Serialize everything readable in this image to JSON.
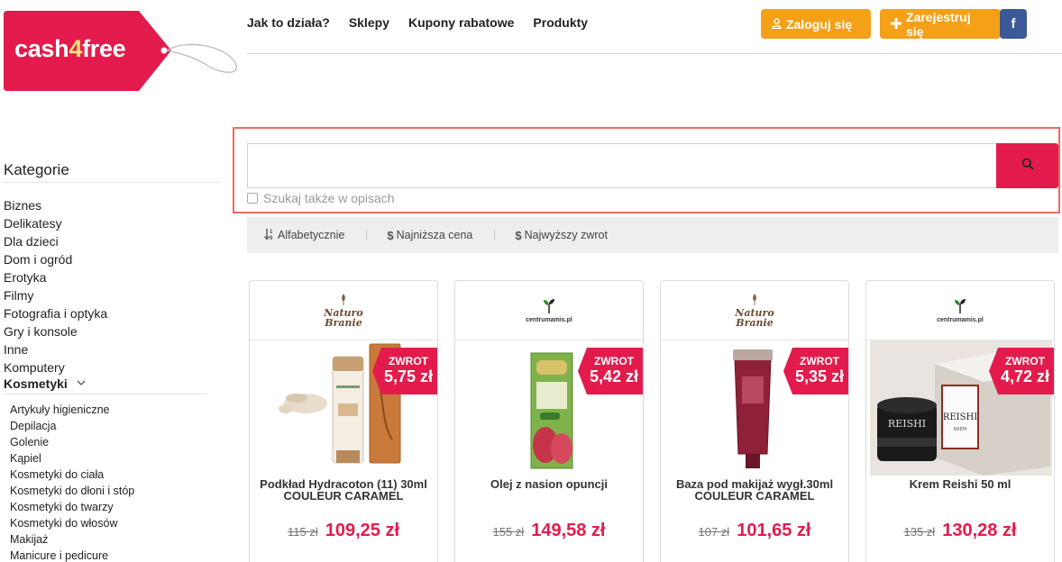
{
  "brand": {
    "logo_main": "cash",
    "logo_four": "4",
    "logo_end": "free",
    "colors": {
      "primary": "#e31b4c",
      "accent": "#f4a018",
      "facebook": "#3b5998"
    }
  },
  "nav": {
    "items": [
      "Jak to działa?",
      "Sklepy",
      "Kupony rabatowe",
      "Produkty"
    ],
    "login_label": "Zaloguj się",
    "register_label": "Zarejestruj się",
    "facebook_label": "f"
  },
  "sidebar": {
    "title": "Kategorie",
    "categories": [
      "Biznes",
      "Delikatesy",
      "Dla dzieci",
      "Dom i ogród",
      "Erotyka",
      "Filmy",
      "Fotografia i optyka",
      "Gry i konsole",
      "Inne",
      "Komputery"
    ],
    "active_category": "Kosmetyki",
    "subcategories": [
      "Artykuły higieniczne",
      "Depilacja",
      "Golenie",
      "Kąpiel",
      "Kosmetyki do ciała",
      "Kosmetyki do dłoni i stóp",
      "Kosmetyki do twarzy",
      "Kosmetyki do włosów",
      "Makijaż",
      "Manicure i pedicure"
    ]
  },
  "search": {
    "value": "",
    "placeholder": "",
    "checkbox_label": "Szukaj także w opisach"
  },
  "sort": {
    "alpha_label": "Alfabetycznie",
    "lowest_price_label": "Najniższa cena",
    "highest_cashback_label": "Najwyższy zwrot"
  },
  "products": [
    {
      "shop": "naturo",
      "shop_line1": "Naturo",
      "shop_line2": "Branie",
      "cashback_label": "ZWROT",
      "cashback": "5,75 zł",
      "name": "Podkład Hydracoton (11) 30ml COULEUR CARAMEL",
      "old_price": "115 zł",
      "new_price": "109,25 zł"
    },
    {
      "shop": "centrumamis",
      "shop_line1": "centrumamis.pl",
      "cashback_label": "ZWROT",
      "cashback": "5,42 zł",
      "name": "Olej z nasion opuncji",
      "old_price": "155 zł",
      "new_price": "149,58 zł"
    },
    {
      "shop": "naturo",
      "shop_line1": "Naturo",
      "shop_line2": "Branie",
      "cashback_label": "ZWROT",
      "cashback": "5,35 zł",
      "name": "Baza pod makijaż wygł.30ml COULEUR CARAMEL",
      "old_price": "107 zł",
      "new_price": "101,65 zł"
    },
    {
      "shop": "centrumamis",
      "shop_line1": "centrumamis.pl",
      "cashback_label": "ZWROT",
      "cashback": "4,72 zł",
      "name": "Krem Reishi 50 ml",
      "old_price": "135 zł",
      "new_price": "130,28 zł",
      "box_label": "REISHI",
      "box_sub": "KREM"
    }
  ]
}
